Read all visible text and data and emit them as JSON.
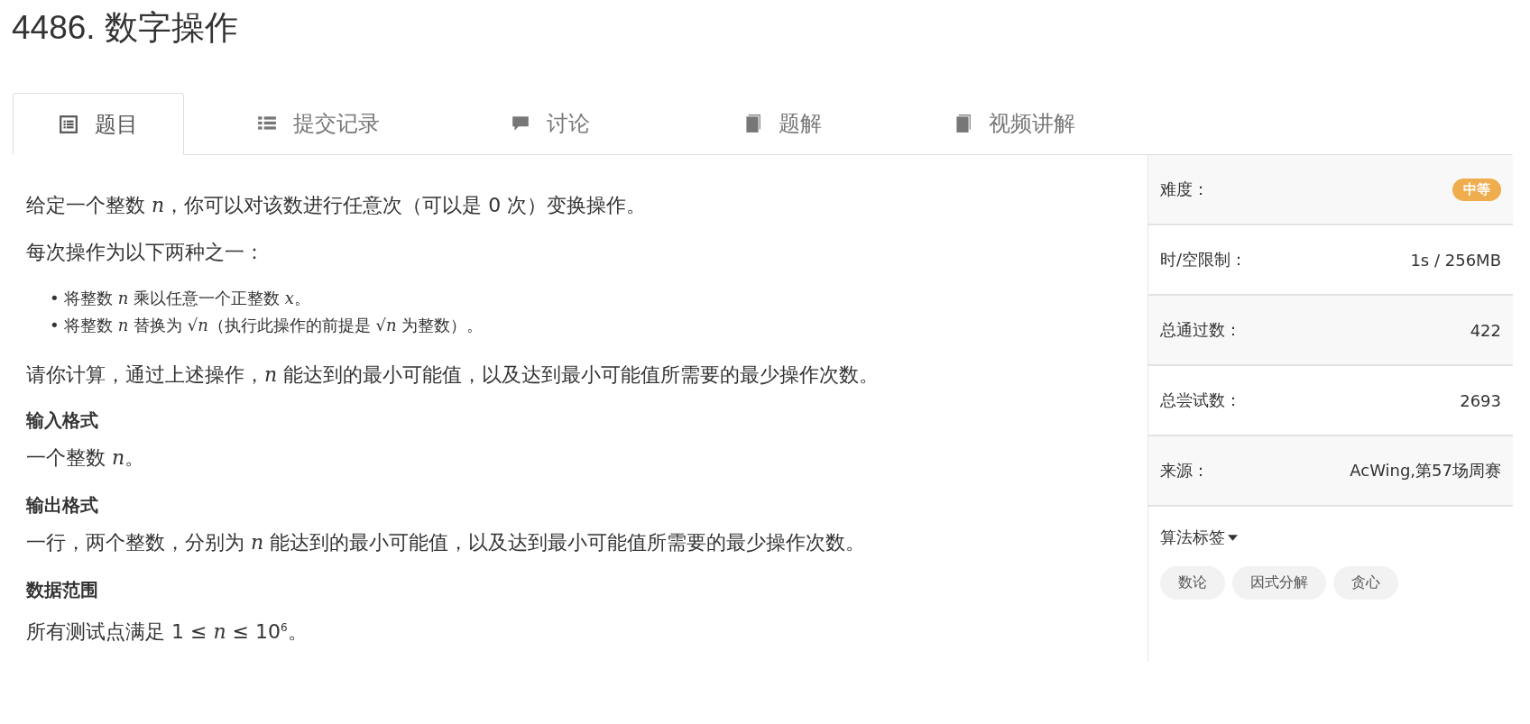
{
  "title": "4486. 数字操作",
  "tabs": [
    {
      "label": "题目",
      "selected": true,
      "kind": "document"
    },
    {
      "label": "提交记录",
      "selected": false,
      "kind": "list"
    },
    {
      "label": "讨论",
      "selected": false,
      "kind": "comment"
    },
    {
      "label": "题解",
      "selected": false,
      "kind": "book"
    },
    {
      "label": "视频讲解",
      "selected": false,
      "kind": "book"
    }
  ],
  "problem": [
    {
      "kind": "paragraph",
      "text": "给定一个整数 *n*，你可以对该数进行任意次（可以是 0 次）变换操作。"
    },
    {
      "kind": "paragraph",
      "text": "每次操作为以下两种之一："
    },
    {
      "kind": "list",
      "items": [
        {
          "marker": "•",
          "text": "将整数 *n* 乘以任意一个正整数 *x*。"
        },
        {
          "marker": "•",
          "text": "将整数 *n* 替换为 √*n*（执行此操作的前提是 √*n* 为整数）。"
        }
      ]
    },
    {
      "kind": "paragraph",
      "text": "请你计算，通过上述操作，*n* 能达到的最小可能值，以及达到最小可能值所需要的最少操作次数。"
    },
    {
      "kind": "heading",
      "text": "输入格式"
    },
    {
      "kind": "line",
      "text": "一个整数 *n*。"
    },
    {
      "kind": "heading",
      "text": "输出格式"
    },
    {
      "kind": "line",
      "text": "一行，两个整数，分别为 *n* 能达到的最小可能值，以及达到最小可能值所需要的最少操作次数。"
    },
    {
      "kind": "heading",
      "text": "数据范围"
    },
    {
      "kind": "line",
      "text": "所有测试点满足 1 ≤ *n* ≤ 10$^{6}$。"
    }
  ],
  "sidebar": {
    "rows": [
      {
        "label": "难度：",
        "value": "中等",
        "kind": "badge"
      },
      {
        "label": "时/空限制：",
        "value": "1s / 256MB",
        "kind": "text"
      },
      {
        "label": "总通过数：",
        "value": "422",
        "kind": "text"
      },
      {
        "label": "总尝试数：",
        "value": "2693",
        "kind": "text"
      },
      {
        "label": "来源：",
        "value": "AcWing,第57场周赛",
        "kind": "text"
      }
    ],
    "tags_label": "算法标签",
    "tags": [
      "数论",
      "因式分解",
      "贪心"
    ]
  }
}
